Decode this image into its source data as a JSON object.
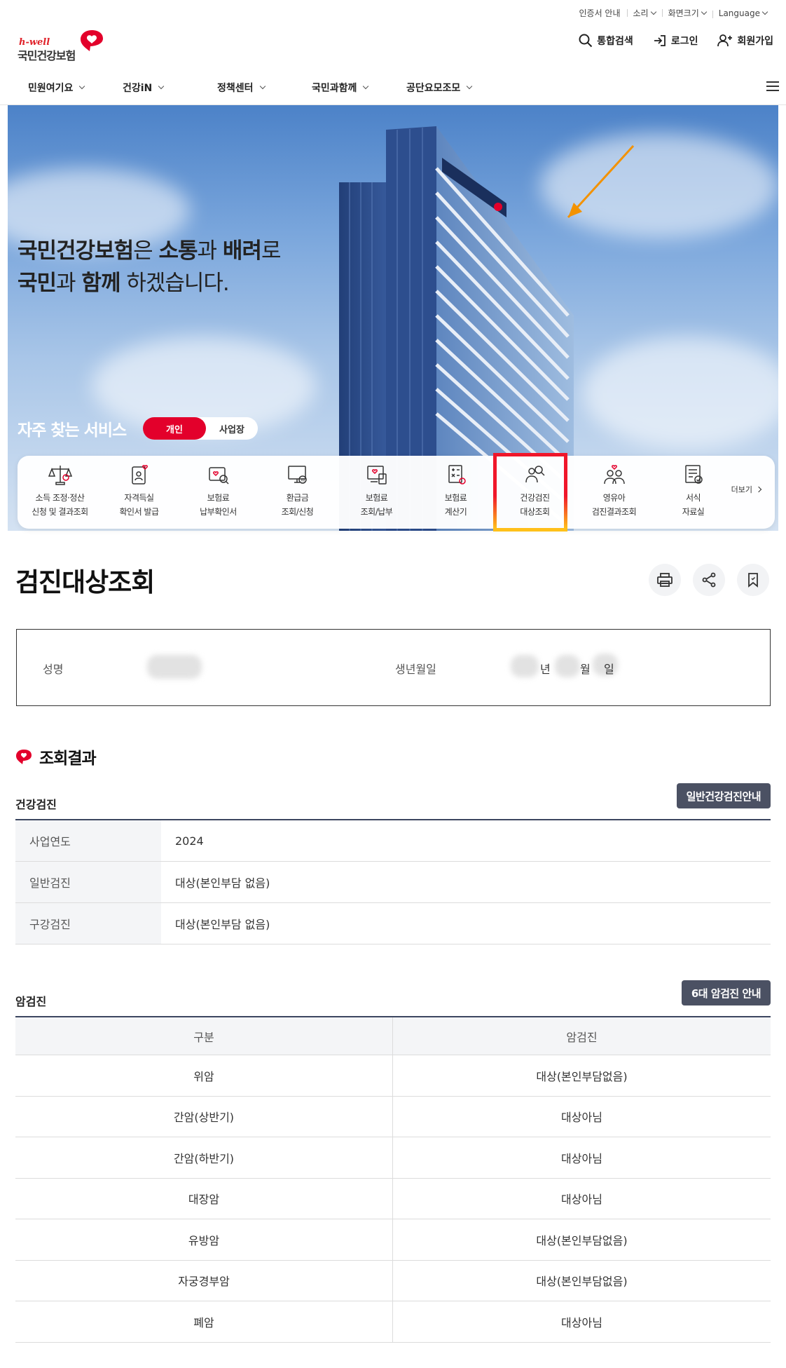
{
  "util": {
    "cert": "인증서 안내",
    "sound": "소리",
    "zoom": "화면크기",
    "lang": "Language"
  },
  "logo": {
    "tag": "h-well",
    "name": "국민건강보험"
  },
  "header": {
    "search": "통합검색",
    "login": "로그인",
    "join": "회원가입"
  },
  "nav": [
    "민원여기요",
    "건강iN",
    "정책센터",
    "국민과함께",
    "공단요모조모"
  ],
  "hero": {
    "line1_a": "국민건강보험",
    "line1_b": "은 ",
    "line1_c": "소통",
    "line1_d": "과 ",
    "line1_e": "배려",
    "line1_f": "로",
    "line2_a": "국민",
    "line2_b": "과 ",
    "line2_c": "함께",
    "line2_d": " 하겠습니다.",
    "freq": "자주 찾는 서비스",
    "toggle_on": "개인",
    "toggle_off": "사업장"
  },
  "services": [
    {
      "l1": "소득 조정·정산",
      "l2": "신청 및 결과조회",
      "icon": "scale-icon"
    },
    {
      "l1": "자격득실",
      "l2": "확인서 발급",
      "icon": "certificate-icon"
    },
    {
      "l1": "보험료",
      "l2": "납부확인서",
      "icon": "payment-search-icon"
    },
    {
      "l1": "환급금",
      "l2": "조회/신청",
      "icon": "refund-monitor-icon"
    },
    {
      "l1": "보험료",
      "l2": "조회/납부",
      "icon": "bill-pay-icon"
    },
    {
      "l1": "보험료",
      "l2": "계산기",
      "icon": "calculator-icon"
    },
    {
      "l1": "건강검진",
      "l2": "대상조회",
      "icon": "person-search-icon"
    },
    {
      "l1": "영유아",
      "l2": "검진결과조회",
      "icon": "family-icon"
    },
    {
      "l1": "서식",
      "l2": "자료실",
      "icon": "document-check-icon"
    }
  ],
  "more": "더보기",
  "page_title": "검진대상조회",
  "info": {
    "name_label": "성명",
    "birth_label": "생년월일",
    "birth_year": "년",
    "birth_month": "월",
    "birth_day": "일"
  },
  "result_title": "조회결과",
  "health": {
    "title": "건강검진",
    "button": "일반건강검진안내",
    "rows": [
      {
        "k": "사업연도",
        "v": "2024"
      },
      {
        "k": "일반검진",
        "v": "대상(본인부담 없음)"
      },
      {
        "k": "구강검진",
        "v": "대상(본인부담 없음)"
      }
    ]
  },
  "cancer": {
    "title": "암검진",
    "button": "6대 암검진 안내",
    "headers": [
      "구분",
      "암검진"
    ],
    "rows": [
      [
        "위암",
        "대상(본인부담없음)"
      ],
      [
        "간암(상반기)",
        "대상아님"
      ],
      [
        "간암(하반기)",
        "대상아님"
      ],
      [
        "대장암",
        "대상아님"
      ],
      [
        "유방암",
        "대상(본인부담없음)"
      ],
      [
        "자궁경부암",
        "대상(본인부담없음)"
      ],
      [
        "폐암",
        "대상아님"
      ]
    ]
  },
  "colors": {
    "brand_red": "#e3002b",
    "dark_button": "#4b5163",
    "highlight_top": "#f0162a",
    "highlight_bottom": "#ffc21a",
    "arrow": "#f39200"
  }
}
